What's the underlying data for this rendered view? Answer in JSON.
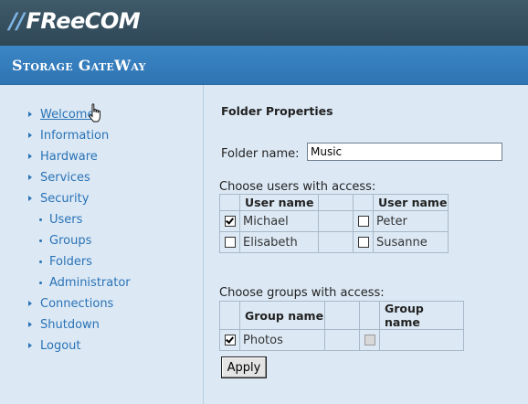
{
  "brand": {
    "logo_bars": "//",
    "logo_text": "FReeCOM"
  },
  "app": {
    "title": "Storage GateWay"
  },
  "nav": {
    "items": [
      {
        "label": "Welcome",
        "level": "main"
      },
      {
        "label": "Information",
        "level": "main"
      },
      {
        "label": "Hardware",
        "level": "main"
      },
      {
        "label": "Services",
        "level": "main"
      },
      {
        "label": "Security",
        "level": "main"
      },
      {
        "label": "Users",
        "level": "sub"
      },
      {
        "label": "Groups",
        "level": "sub"
      },
      {
        "label": "Folders",
        "level": "sub"
      },
      {
        "label": "Administrator",
        "level": "sub"
      },
      {
        "label": "Connections",
        "level": "main"
      },
      {
        "label": "Shutdown",
        "level": "main"
      },
      {
        "label": "Logout",
        "level": "main"
      }
    ]
  },
  "main": {
    "heading": "Folder Properties",
    "folder_name_label": "Folder name:",
    "folder_name_value": "Music",
    "users_caption": "Choose users with access:",
    "users_header": [
      "User name",
      "User name"
    ],
    "users": [
      [
        {
          "name": "Michael",
          "checked": true
        },
        {
          "name": "Peter",
          "checked": false
        }
      ],
      [
        {
          "name": "Elisabeth",
          "checked": false
        },
        {
          "name": "Susanne",
          "checked": false
        }
      ]
    ],
    "groups_caption": "Choose groups with access:",
    "groups_header": [
      "Group name",
      "Group name"
    ],
    "groups": [
      [
        {
          "name": "Photos",
          "checked": true
        },
        {
          "name": "",
          "checked": false,
          "disabled": true
        }
      ]
    ],
    "apply_label": "Apply"
  },
  "colors": {
    "topbar": "#2f4756",
    "titlebar": "#2f74b3",
    "background": "#dce9f5",
    "nav_link": "#2a72b5"
  }
}
